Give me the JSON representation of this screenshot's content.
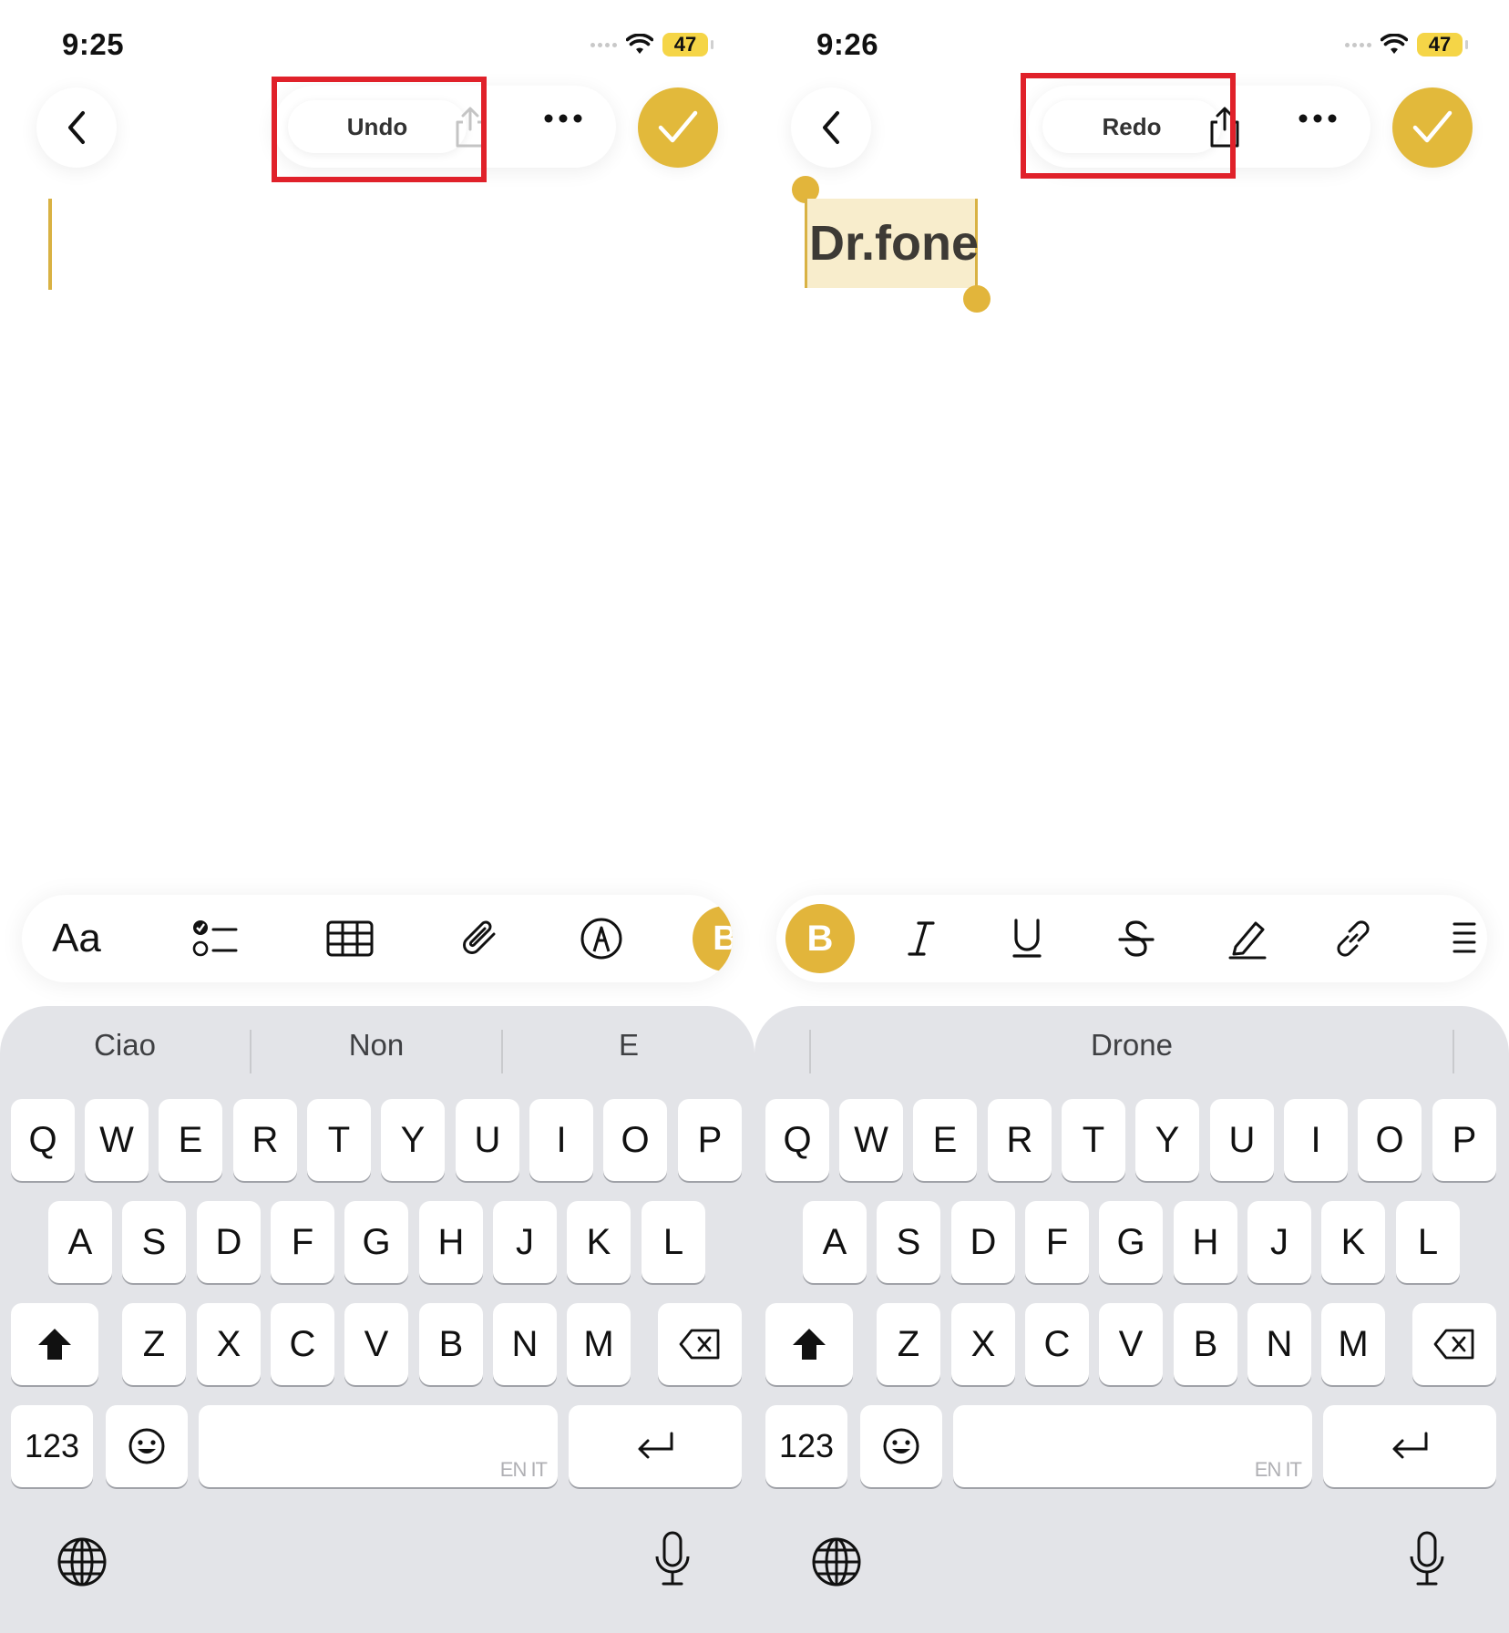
{
  "left": {
    "status": {
      "time": "9:25",
      "battery": "47"
    },
    "toolbar": {
      "action_label": "Undo"
    },
    "format_bar": {
      "items": [
        "Aa",
        "checklist-icon",
        "table-icon",
        "paperclip-icon",
        "markup-pen-icon",
        "bold-icon"
      ],
      "aa_label": "Aa",
      "partial_label": "B"
    },
    "keyboard": {
      "suggestions": [
        "Ciao",
        "Non",
        "E"
      ],
      "row1": [
        "Q",
        "W",
        "E",
        "R",
        "T",
        "Y",
        "U",
        "I",
        "O",
        "P"
      ],
      "row2": [
        "A",
        "S",
        "D",
        "F",
        "G",
        "H",
        "J",
        "K",
        "L"
      ],
      "row3": [
        "Z",
        "X",
        "C",
        "V",
        "B",
        "N",
        "M"
      ],
      "numbers_label": "123",
      "space_lang": "EN IT"
    }
  },
  "right": {
    "status": {
      "time": "9:26",
      "battery": "47"
    },
    "toolbar": {
      "action_label": "Redo"
    },
    "note": {
      "selected_text": "Dr.fone"
    },
    "format_bar": {
      "bold_label": "B",
      "items": [
        "bold-icon",
        "italic-icon",
        "underline-icon",
        "strikethrough-icon",
        "highlighter-icon",
        "link-icon",
        "list-icon"
      ]
    },
    "keyboard": {
      "suggestions": [
        "",
        "Drone",
        ""
      ],
      "row1": [
        "Q",
        "W",
        "E",
        "R",
        "T",
        "Y",
        "U",
        "I",
        "O",
        "P"
      ],
      "row2": [
        "A",
        "S",
        "D",
        "F",
        "G",
        "H",
        "J",
        "K",
        "L"
      ],
      "row3": [
        "Z",
        "X",
        "C",
        "V",
        "B",
        "N",
        "M"
      ],
      "numbers_label": "123",
      "space_lang": "EN IT"
    }
  },
  "colors": {
    "accent": "#E2B53B",
    "highlight_box": "#E0212A",
    "keyboard_bg": "#E3E4E8"
  }
}
